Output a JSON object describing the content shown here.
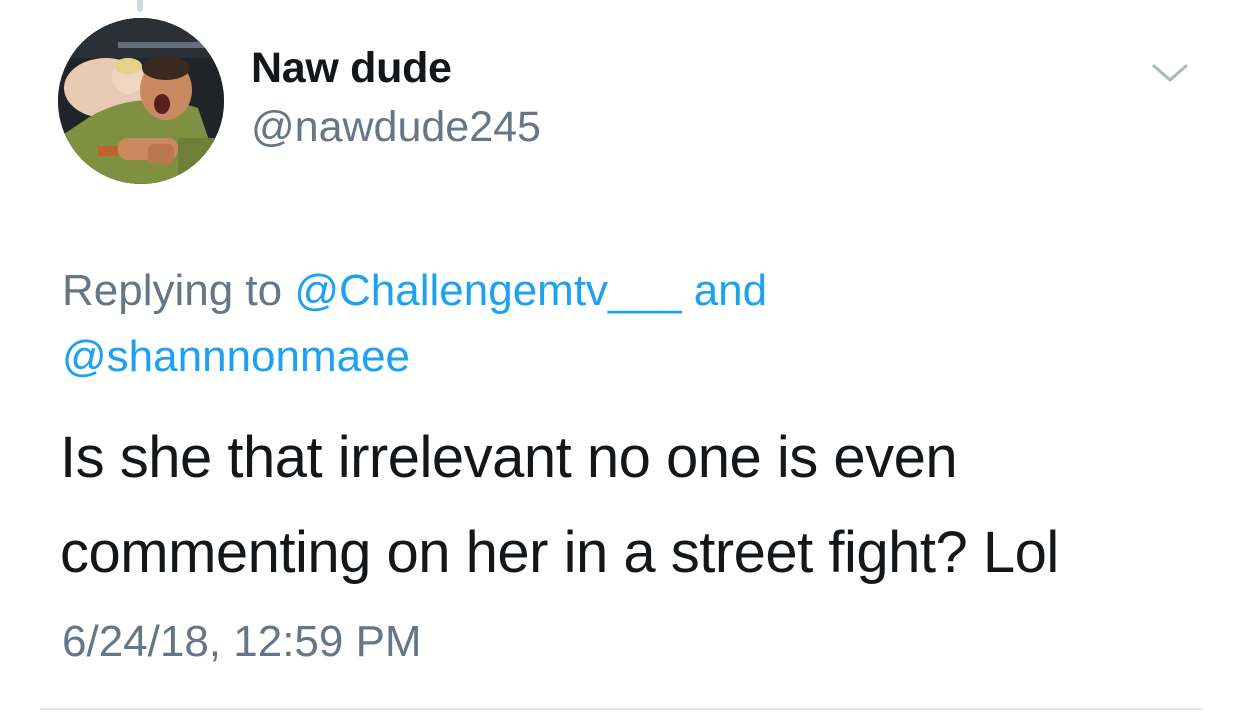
{
  "tweet": {
    "display_name": "Naw dude",
    "handle": "@nawdude245",
    "reply_prefix": "Replying to ",
    "reply_mention_1": "@Challengemtv___",
    "reply_joiner": " and ",
    "reply_mention_2": "@shannnonmaee",
    "text_line_1": "Is she that irrelevant no one is even",
    "text_line_2": "commenting on her in a street fight? Lol",
    "timestamp": "6/24/18, 12:59 PM"
  },
  "colors": {
    "text_primary": "#14171a",
    "text_secondary": "#657786",
    "link": "#1da1f2",
    "divider": "#e1e8ed",
    "chevron": "#aab8c2"
  },
  "icons": {
    "more_menu": "chevron-down-icon"
  }
}
